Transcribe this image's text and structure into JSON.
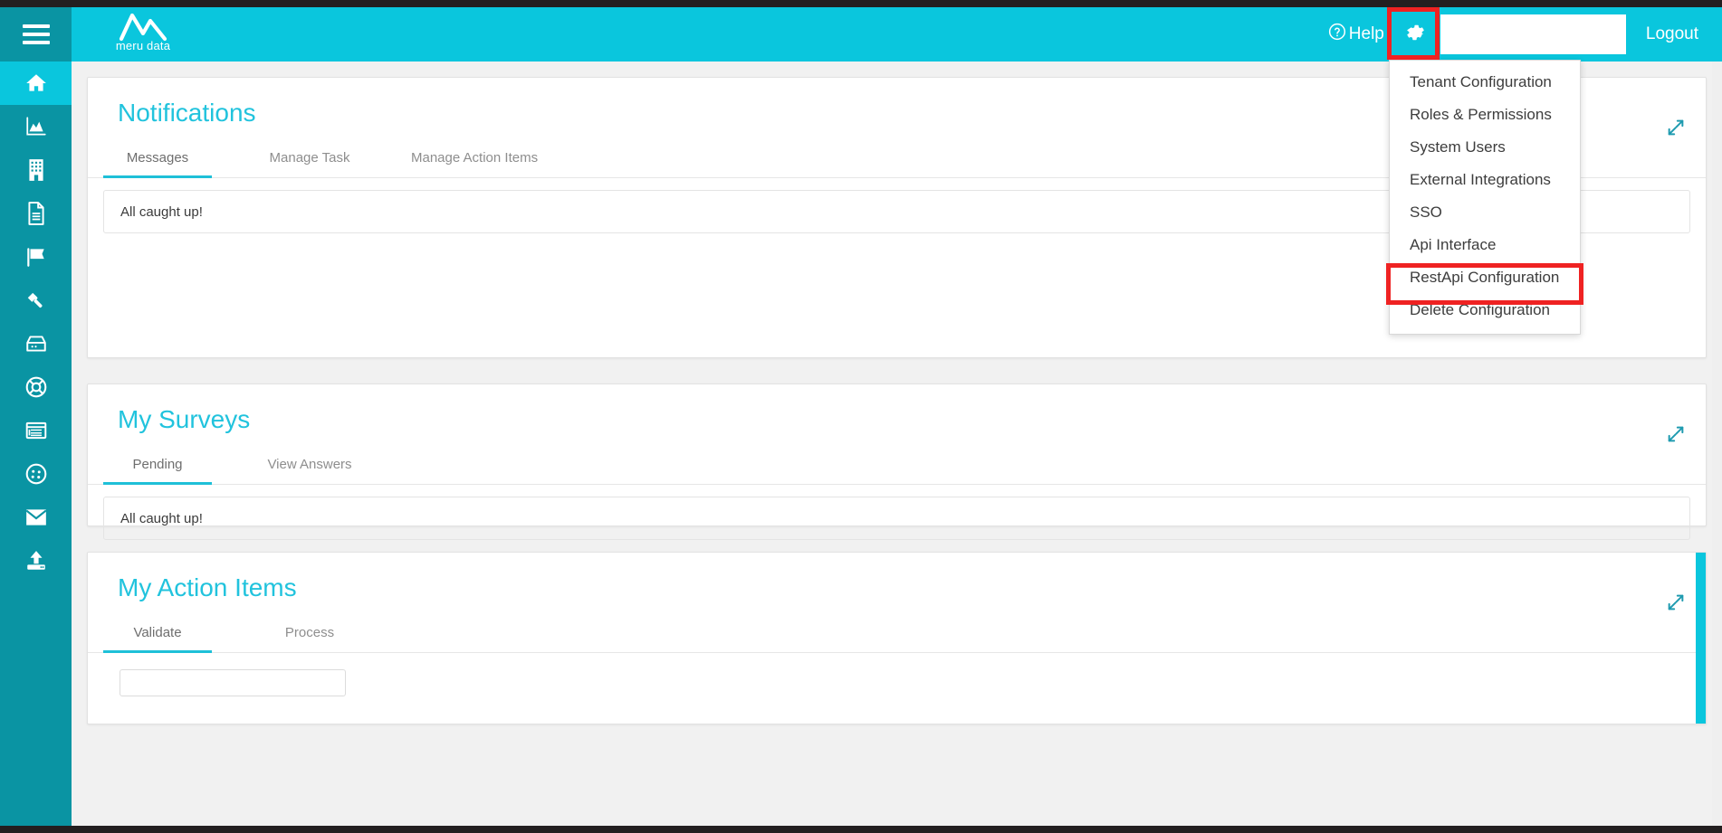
{
  "brand": {
    "logo_text": "meru data",
    "accent_header": "#0ac6dd",
    "accent_sidebar": "#0a94a3",
    "accent_title": "#21c3dd",
    "highlight_red": "#ef2222"
  },
  "header": {
    "help_label": "Help",
    "logout_label": "Logout"
  },
  "sidebar": {
    "items": [
      {
        "name": "home",
        "label": "Home",
        "active": true
      },
      {
        "name": "analytics",
        "label": "Analytics",
        "active": false
      },
      {
        "name": "organization",
        "label": "Organization",
        "active": false
      },
      {
        "name": "documents",
        "label": "Documents",
        "active": false
      },
      {
        "name": "flag",
        "label": "Flags",
        "active": false
      },
      {
        "name": "gavel",
        "label": "Legal",
        "active": false
      },
      {
        "name": "database",
        "label": "Data Store",
        "active": false
      },
      {
        "name": "lifebuoy",
        "label": "Support",
        "active": false
      },
      {
        "name": "list",
        "label": "Records",
        "active": false
      },
      {
        "name": "cookie",
        "label": "Cookies",
        "active": false
      },
      {
        "name": "envelope",
        "label": "Mail",
        "active": false
      },
      {
        "name": "upload",
        "label": "Upload",
        "active": false
      }
    ]
  },
  "settings_menu": {
    "open": true,
    "highlighted_item": "RestApi Configuration",
    "items": [
      "Tenant Configuration",
      "Roles & Permissions",
      "System Users",
      "External Integrations",
      "SSO",
      "Api Interface",
      "RestApi Configuration",
      "Delete Configuration"
    ]
  },
  "cards": [
    {
      "title": "Notifications",
      "tabs": [
        {
          "label": "Messages",
          "active": true
        },
        {
          "label": "Manage Task",
          "active": false
        },
        {
          "label": "Manage Action Items",
          "active": false
        }
      ],
      "empty_message": "All caught up!"
    },
    {
      "title": "My Surveys",
      "tabs": [
        {
          "label": "Pending",
          "active": true
        },
        {
          "label": "View Answers",
          "active": false
        }
      ],
      "empty_message": "All caught up!"
    },
    {
      "title": "My Action Items",
      "tabs": [
        {
          "label": "Validate",
          "active": true
        },
        {
          "label": "Process",
          "active": false
        }
      ],
      "empty_message": ""
    }
  ]
}
